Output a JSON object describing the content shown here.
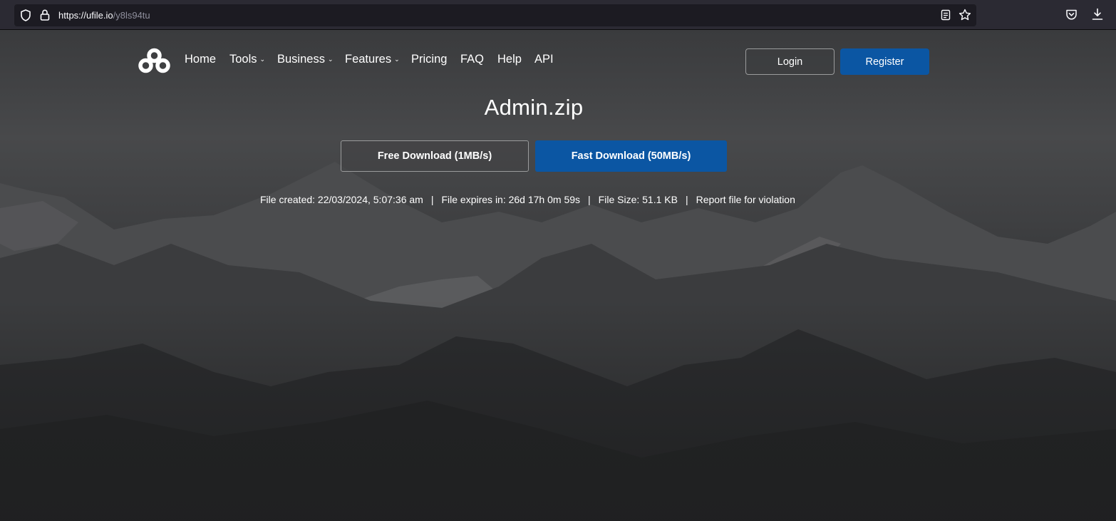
{
  "browser": {
    "url_host": "https://ufile.io",
    "url_path": "/y8ls94tu"
  },
  "nav": {
    "items": [
      {
        "label": "Home",
        "dropdown": false
      },
      {
        "label": "Tools",
        "dropdown": true
      },
      {
        "label": "Business",
        "dropdown": true
      },
      {
        "label": "Features",
        "dropdown": true
      },
      {
        "label": "Pricing",
        "dropdown": false
      },
      {
        "label": "FAQ",
        "dropdown": false
      },
      {
        "label": "Help",
        "dropdown": false
      },
      {
        "label": "API",
        "dropdown": false
      }
    ],
    "caret": "⌄"
  },
  "auth": {
    "login_label": "Login",
    "register_label": "Register"
  },
  "file": {
    "name": "Admin.zip",
    "free_download_label": "Free Download (1MB/s)",
    "fast_download_label": "Fast Download (50MB/s)",
    "created": "File created: 22/03/2024, 5:07:36 am",
    "expires": "File expires in: 26d 17h 0m 59s",
    "size": "File Size: 51.1 KB",
    "report": "Report file for violation",
    "separator": "|"
  },
  "colors": {
    "accent_blue": "#0b56a3",
    "chrome_bg": "#2b2a33",
    "urlbar_bg": "#1c1b22"
  }
}
